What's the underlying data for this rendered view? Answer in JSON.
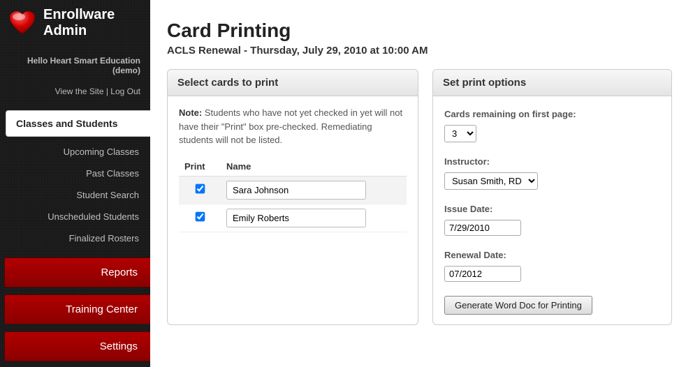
{
  "brand": {
    "line1": "Enrollware",
    "line2": "Admin"
  },
  "account": {
    "greeting": "Hello Heart Smart Education (demo)",
    "view_site": "View the Site",
    "sep": " | ",
    "logout": "Log Out"
  },
  "nav": {
    "active": "Classes and Students",
    "sub": {
      "upcoming": "Upcoming Classes",
      "past": "Past Classes",
      "search": "Student Search",
      "unscheduled": "Unscheduled Students",
      "finalized": "Finalized Rosters"
    },
    "reports": "Reports",
    "training": "Training Center",
    "settings": "Settings"
  },
  "page": {
    "title": "Card Printing",
    "subtitle": "ACLS Renewal - Thursday, July 29, 2010 at 10:00 AM"
  },
  "select_panel": {
    "header": "Select cards to print",
    "note_label": "Note:",
    "note_body": " Students who have not yet checked in yet will not have their \"Print\" box pre-checked. Remediating students will not be listed.",
    "col_print": "Print",
    "col_name": "Name",
    "students": [
      {
        "name": "Sara Johnson"
      },
      {
        "name": "Emily Roberts"
      }
    ]
  },
  "options_panel": {
    "header": "Set print options",
    "remaining_label": "Cards remaining on first page:",
    "remaining_value": "3",
    "instructor_label": "Instructor:",
    "instructor_value": "Susan Smith, RD",
    "issue_label": "Issue Date:",
    "issue_value": "7/29/2010",
    "renewal_label": "Renewal Date:",
    "renewal_value": "07/2012",
    "generate_label": "Generate Word Doc for Printing"
  }
}
